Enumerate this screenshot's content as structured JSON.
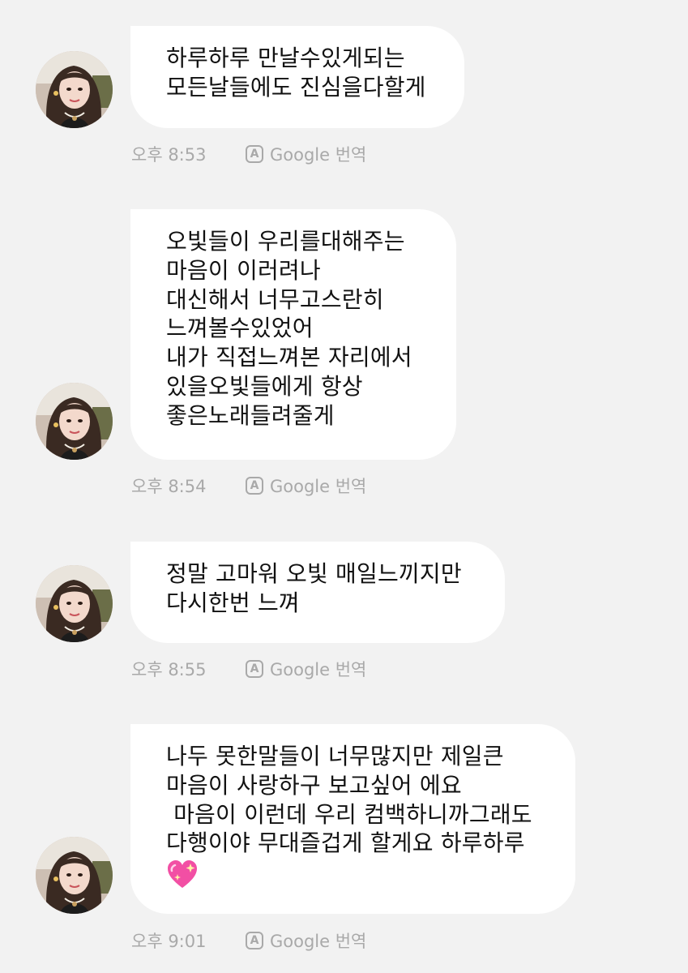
{
  "messages": [
    {
      "lines": [
        "하루하루 만날수있게되는",
        "모든날들에도 진심을다할게"
      ],
      "time": "오후 8:53",
      "translate_icon": "A",
      "translate_label": "Google 번역"
    },
    {
      "lines": [
        "오빛들이 우리를대해주는",
        "마음이 이러려나",
        "대신해서 너무고스란히",
        "느껴볼수있었어",
        "내가 직접느껴본 자리에서",
        "있을오빛들에게 항상",
        "좋은노래들려줄게"
      ],
      "time": "오후 8:54",
      "translate_icon": "A",
      "translate_label": "Google 번역"
    },
    {
      "lines": [
        "정말 고마워 오빛 매일느끼지만",
        "다시한번 느껴"
      ],
      "time": "오후 8:55",
      "translate_icon": "A",
      "translate_label": "Google 번역"
    },
    {
      "lines": [
        "나두 못한말들이 너무많지만 제일큰",
        "마음이 사랑하구 보고싶어 에요",
        " 마음이 이런데 우리 컴백하니까그래도",
        "다행이야 무대즐겁게 할게요 하루하루"
      ],
      "emoji": "sparkling-heart-icon",
      "time": "오후 9:01",
      "translate_icon": "A",
      "translate_label": "Google 번역"
    }
  ],
  "colors": {
    "background": "#f2f2f2",
    "bubble": "#ffffff",
    "text": "#111111",
    "meta": "#a9a9a9",
    "heart": "#f24fa4"
  }
}
